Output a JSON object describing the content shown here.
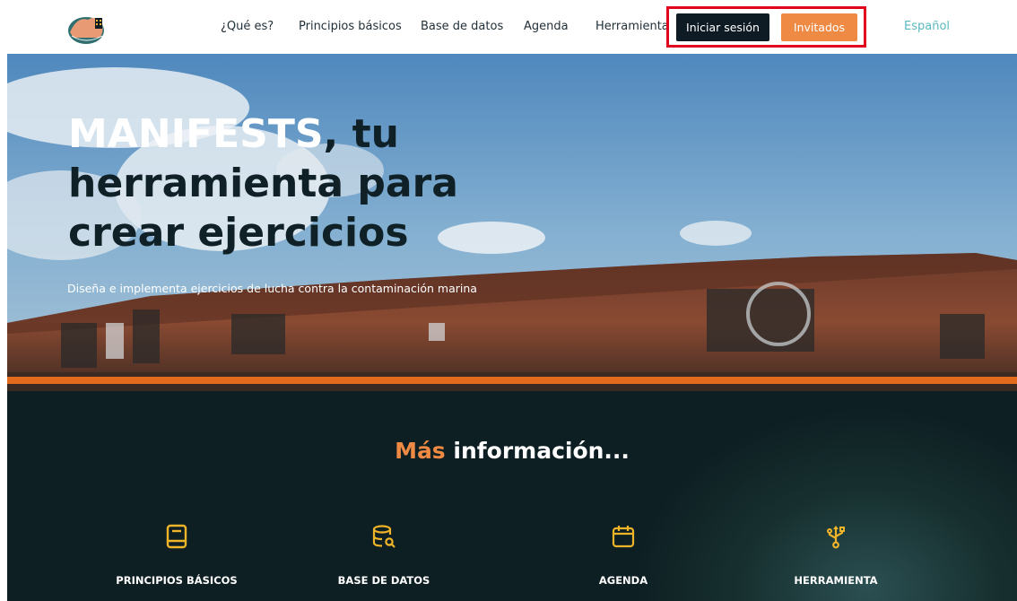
{
  "nav": {
    "items": [
      {
        "label": "¿Qué es?"
      },
      {
        "label": "Principios básicos"
      },
      {
        "label": "Base de datos"
      },
      {
        "label": "Agenda"
      },
      {
        "label": "Herramienta"
      }
    ],
    "login_label": "Iniciar sesión",
    "guest_label": "Invitados",
    "language": "Español"
  },
  "hero": {
    "title_brand": "MANIFESTS",
    "title_rest": ", tu herramienta para crear ejercicios",
    "subtitle": "Diseña e implementa ejercicios de lucha contra la contaminación marina"
  },
  "info": {
    "title_accent": "Más",
    "title_rest": " información...",
    "cards": [
      {
        "label": "PRINCIPIOS BÁSICOS",
        "icon": "book-icon"
      },
      {
        "label": "BASE DE DATOS",
        "icon": "database-search-icon"
      },
      {
        "label": "AGENDA",
        "icon": "calendar-icon"
      },
      {
        "label": "HERRAMIENTA",
        "icon": "usb-icon"
      }
    ]
  },
  "colors": {
    "accent": "#ee8a44",
    "dark": "#0f1b24",
    "language": "#5bb9be",
    "highlight": "#e0001b",
    "icon": "#f0b429"
  }
}
